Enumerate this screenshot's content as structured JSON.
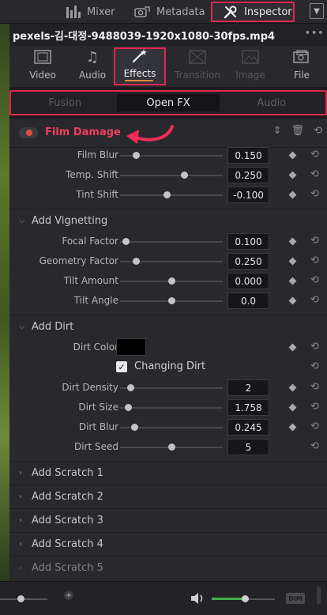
{
  "topbar": {
    "tabs": [
      {
        "label": "Mixer"
      },
      {
        "label": "Metadata"
      },
      {
        "label": "Inspector"
      }
    ]
  },
  "clip": {
    "name": "pexels-김-대정-9488039-1920x1080-30fps.mp4",
    "more": "•••"
  },
  "inspector_tabs": [
    {
      "label": "Video",
      "icon": "film-icon"
    },
    {
      "label": "Audio",
      "icon": "music-note-icon"
    },
    {
      "label": "Effects",
      "icon": "magic-wand-icon"
    },
    {
      "label": "Transition",
      "icon": "transition-icon"
    },
    {
      "label": "Image",
      "icon": "image-icon"
    },
    {
      "label": "File",
      "icon": "file-icon"
    }
  ],
  "sub_tabs": [
    {
      "label": "Fusion"
    },
    {
      "label": "Open FX"
    },
    {
      "label": "Audio"
    }
  ],
  "effect": {
    "title": "Film Damage",
    "accent": "#ef3f5a",
    "params_top": [
      {
        "label": "Film Blur",
        "value": "0.150",
        "slider": 0.15
      },
      {
        "label": "Temp. Shift",
        "value": "0.250",
        "slider": 0.62
      },
      {
        "label": "Tint Shift",
        "value": "-0.100",
        "slider": 0.45
      }
    ],
    "vignetting": {
      "title": "Add Vignetting",
      "params": [
        {
          "label": "Focal Factor",
          "value": "0.100",
          "slider": 0.05
        },
        {
          "label": "Geometry Factor",
          "value": "0.250",
          "slider": 0.15
        },
        {
          "label": "Tilt Amount",
          "value": "0.000",
          "slider": 0.5
        },
        {
          "label": "Tilt Angle",
          "value": "0.0",
          "slider": 0.5
        }
      ]
    },
    "dirt": {
      "title": "Add Dirt",
      "color_label": "Dirt Color",
      "color_value": "#000000",
      "changing_label": "Changing Dirt",
      "changing_checked": true,
      "params": [
        {
          "label": "Dirt Density",
          "value": "2",
          "slider": 0.1
        },
        {
          "label": "Dirt Size",
          "value": "1.758",
          "slider": 0.08
        },
        {
          "label": "Dirt Blur",
          "value": "0.245",
          "slider": 0.14
        },
        {
          "label": "Dirt Seed",
          "value": "5",
          "slider": 0.5
        }
      ]
    },
    "scratch_groups": [
      {
        "title": "Add Scratch 1"
      },
      {
        "title": "Add Scratch 2"
      },
      {
        "title": "Add Scratch 3"
      },
      {
        "title": "Add Scratch 4"
      },
      {
        "title": "Add Scratch 5"
      }
    ]
  },
  "bottombar": {
    "zoom_plus": "+",
    "volume": 0.52,
    "dim_label": "DIM"
  },
  "colors": {
    "highlight": "#e2264f",
    "effects_underline": "#e0893b",
    "volume_fill": "#41b04a"
  }
}
